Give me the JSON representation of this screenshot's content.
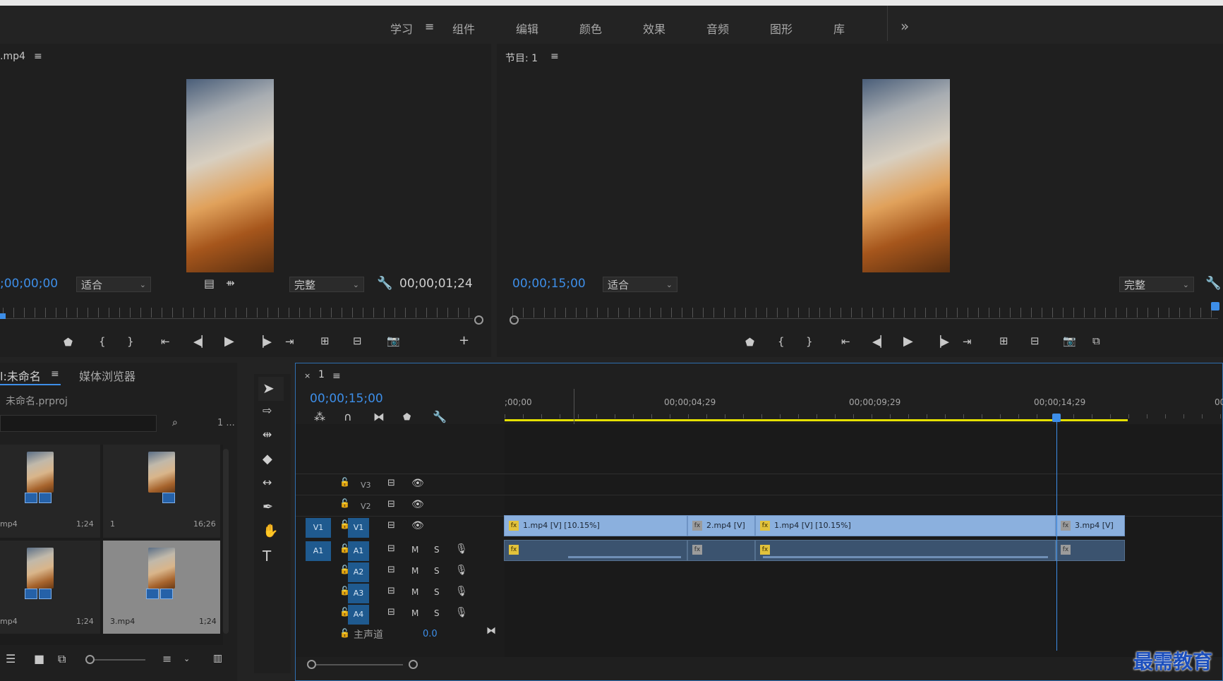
{
  "workspace_tabs": [
    "学习",
    "组件",
    "编辑",
    "颜色",
    "效果",
    "音频",
    "图形",
    "库"
  ],
  "workspace_overflow": "»",
  "source_monitor": {
    "title": ".mp4",
    "timecode": ";00;00;00",
    "fit_label": "适合",
    "quality_label": "完整",
    "duration": "00;00;01;24"
  },
  "program_monitor": {
    "title": "节目: 1",
    "timecode": "00;00;15;00",
    "fit_label": "适合",
    "quality_label": "完整"
  },
  "project_panel": {
    "tab_label": "l:未命名",
    "tab2_label": "媒体浏览器",
    "project_file": "未命名.prproj",
    "item_count": "1 ...",
    "items": [
      {
        "name": "mp4",
        "duration": "1;24"
      },
      {
        "name": "1",
        "duration": "16;26"
      },
      {
        "name": "mp4",
        "duration": "1;24"
      },
      {
        "name": "3.mp4",
        "duration": "1;24"
      }
    ]
  },
  "timeline": {
    "tab_label": "1",
    "timecode": "00;00;15;00",
    "ruler_labels": [
      ";00;00",
      "00;00;04;29",
      "00;00;09;29",
      "00;00;14;29",
      "00"
    ],
    "tracks": {
      "video": [
        "V3",
        "V2",
        "V1"
      ],
      "audio": [
        "A1",
        "A2",
        "A3",
        "A4"
      ],
      "master_label": "主声道",
      "master_value": "0.0",
      "mute": "M",
      "solo": "S"
    },
    "clips": [
      "1.mp4 [V] [10.15%]",
      "2.mp4 [V]",
      "1.mp4 [V] [10.15%]",
      "3.mp4 [V]"
    ],
    "source_patch_v": "V1",
    "source_patch_a": "A1"
  },
  "watermark": "最需教育",
  "colors": {
    "accent_blue": "#3d8ee8",
    "clip_video": "#8bb0de",
    "clip_audio": "#3b536f",
    "work_area": "#e5e000",
    "background": "#232323"
  }
}
